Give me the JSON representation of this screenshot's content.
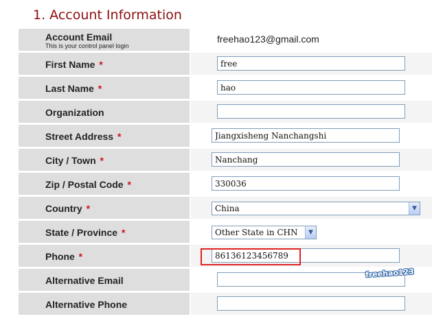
{
  "title": "1. Account Information",
  "account_email": {
    "label": "Account Email",
    "sublabel": "This is your control panel login",
    "value": "freehao123@gmail.com"
  },
  "required_marker": "*",
  "fields": {
    "first_name": {
      "label": "First Name",
      "value": "free"
    },
    "last_name": {
      "label": "Last Name",
      "value": "hao"
    },
    "organization": {
      "label": "Organization",
      "value": ""
    },
    "street_address": {
      "label": "Street Address",
      "value": "Jiangxisheng Nanchangshi"
    },
    "city": {
      "label": "City / Town",
      "value": "Nanchang"
    },
    "zip": {
      "label": "Zip / Postal Code",
      "value": "330036"
    },
    "country": {
      "label": "Country",
      "selected": "China"
    },
    "state": {
      "label": "State / Province",
      "selected": "Other State in CHN"
    },
    "phone": {
      "label": "Phone",
      "value": "86136123456789"
    },
    "alt_email": {
      "label": "Alternative Email",
      "value": ""
    },
    "alt_phone": {
      "label": "Alternative Phone",
      "value": ""
    }
  },
  "icons": {
    "dropdown": "chevron-down-icon"
  },
  "colors": {
    "title": "#8b0d0d",
    "required": "#c8161d",
    "highlight": "#e02020"
  },
  "watermark": "freehao123"
}
